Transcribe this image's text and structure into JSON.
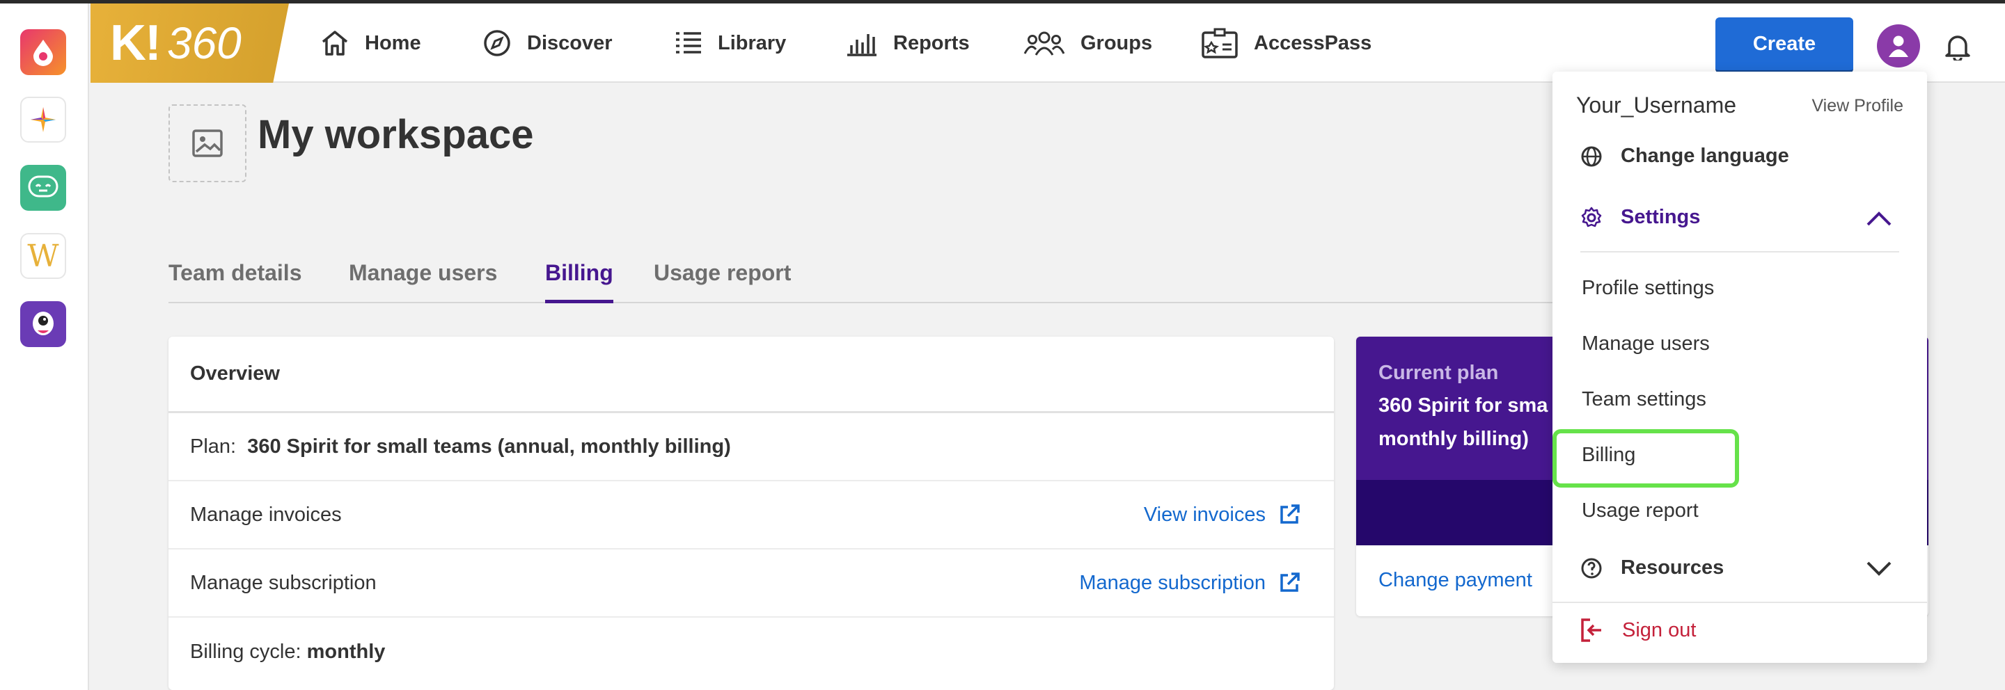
{
  "rail": {
    "apps": [
      "kahoot-app-icon",
      "sparkle-app-icon",
      "chat-bot-app-icon",
      "w-app-icon",
      "monster-app-icon"
    ],
    "w_letter": "W"
  },
  "nav": {
    "logo_k": "K!",
    "logo_num": "360",
    "items": [
      {
        "label": "Home",
        "icon": "house-icon"
      },
      {
        "label": "Discover",
        "icon": "compass-icon"
      },
      {
        "label": "Library",
        "icon": "list-icon"
      },
      {
        "label": "Reports",
        "icon": "bar-chart-icon"
      },
      {
        "label": "Groups",
        "icon": "people-icon"
      },
      {
        "label": "AccessPass",
        "icon": "badge-icon"
      }
    ],
    "create_label": "Create"
  },
  "workspace": {
    "title": "My workspace",
    "tabs": [
      "Team details",
      "Manage users",
      "Billing",
      "Usage report"
    ],
    "active_tab": "Billing"
  },
  "overview": {
    "title": "Overview",
    "plan_label": "Plan:",
    "plan_value": "360 Spirit for small teams (annual, monthly billing)",
    "invoices_label": "Manage invoices",
    "invoices_link": "View invoices",
    "subscription_label": "Manage subscription",
    "subscription_link": "Manage subscription",
    "cycle_label": "Billing cycle:",
    "cycle_value": "monthly"
  },
  "current_plan": {
    "label": "Current plan",
    "name_line1": "360 Spirit for sma",
    "name_line2": "monthly billing)",
    "footer_link": "Change payment"
  },
  "menu": {
    "username": "Your_Username",
    "view_profile": "View Profile",
    "change_language": "Change language",
    "settings": "Settings",
    "settings_items": [
      "Profile settings",
      "Manage users",
      "Team settings",
      "Billing",
      "Usage report"
    ],
    "resources": "Resources",
    "sign_out": "Sign out"
  },
  "colors": {
    "brand_purple": "#46178f",
    "create_blue": "#1f6bd6",
    "link_blue": "#1368ce",
    "highlight_green": "#66e24a",
    "sign_out_red": "#c4213a"
  }
}
